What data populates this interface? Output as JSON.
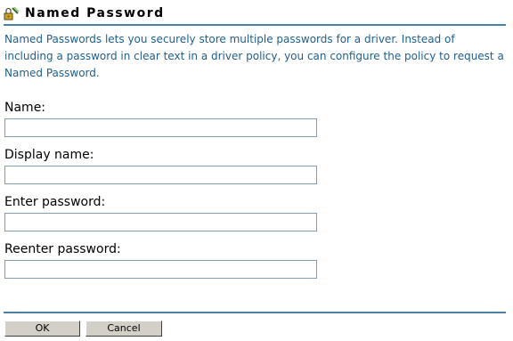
{
  "header": {
    "title": "Named Password",
    "icon": "named-password-icon"
  },
  "description": "Named Passwords lets you securely store multiple passwords for a driver. Instead of including a password in clear text in a driver policy, you can configure the policy to request a Named Password.",
  "fields": {
    "name": {
      "label": "Name:",
      "value": ""
    },
    "display_name": {
      "label": "Display name:",
      "value": ""
    },
    "password": {
      "label": "Enter password:",
      "value": ""
    },
    "reenter_password": {
      "label": "Reenter password:",
      "value": ""
    }
  },
  "buttons": {
    "ok": "OK",
    "cancel": "Cancel"
  },
  "colors": {
    "rule": "#4a7fa7",
    "description_text": "#1f5f8c",
    "button_face": "#d4d0c8"
  }
}
